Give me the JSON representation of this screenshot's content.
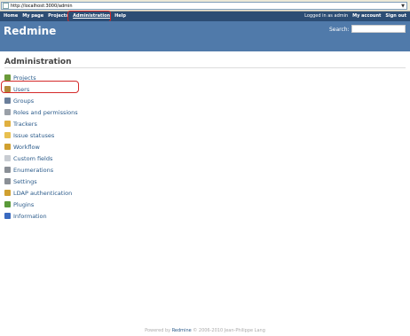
{
  "browser": {
    "url": "http://localhost:3000/admin"
  },
  "top_menu": {
    "left": [
      "Home",
      "My page",
      "Projects",
      "Administration",
      "Help"
    ],
    "logged_in_prefix": "Logged in as",
    "logged_in_user": "admin",
    "right": [
      "My account",
      "Sign out"
    ]
  },
  "header": {
    "title": "Redmine",
    "search_label": "Search:"
  },
  "main": {
    "heading": "Administration",
    "menu": [
      {
        "label": "Projects",
        "icon": "projects-icon",
        "color": "#6b9a3a"
      },
      {
        "label": "Users",
        "icon": "users-icon",
        "color": "#b08a3a"
      },
      {
        "label": "Groups",
        "icon": "groups-icon",
        "color": "#6a7e9a"
      },
      {
        "label": "Roles and permissions",
        "icon": "roles-icon",
        "color": "#9aa0a8"
      },
      {
        "label": "Trackers",
        "icon": "trackers-icon",
        "color": "#e0b040"
      },
      {
        "label": "Issue statuses",
        "icon": "issue-statuses-icon",
        "color": "#e8c050"
      },
      {
        "label": "Workflow",
        "icon": "workflow-icon",
        "color": "#d0a030"
      },
      {
        "label": "Custom fields",
        "icon": "custom-fields-icon",
        "color": "#c8ccd2"
      },
      {
        "label": "Enumerations",
        "icon": "enumerations-icon",
        "color": "#8a8f96"
      },
      {
        "label": "Settings",
        "icon": "settings-icon",
        "color": "#8a8f96"
      },
      {
        "label": "LDAP authentication",
        "icon": "ldap-icon",
        "color": "#d0a030"
      },
      {
        "label": "Plugins",
        "icon": "plugins-icon",
        "color": "#5a9a3a"
      },
      {
        "label": "Information",
        "icon": "information-icon",
        "color": "#3a6ac0"
      }
    ]
  },
  "footer": {
    "prefix": "Powered by",
    "brand": "Redmine",
    "suffix": "© 2006-2010 Jean-Philippe Lang"
  }
}
